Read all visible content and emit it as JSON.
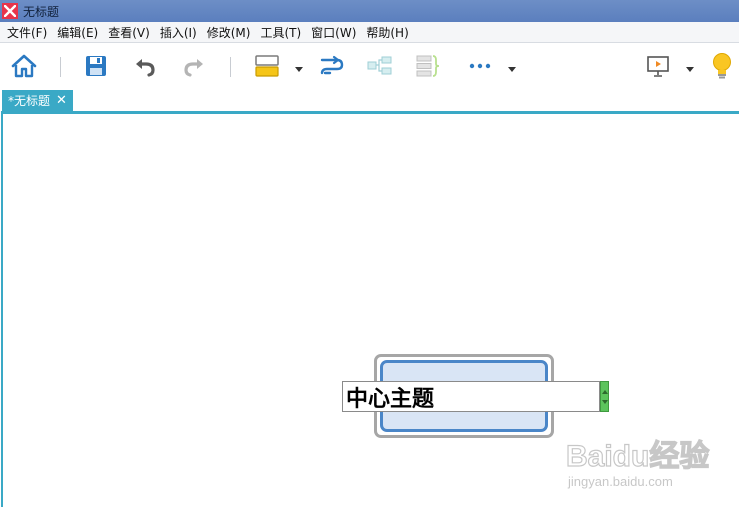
{
  "window": {
    "title": "无标题"
  },
  "menu": {
    "items": [
      {
        "label": "文件(F)"
      },
      {
        "label": "编辑(E)"
      },
      {
        "label": "查看(V)"
      },
      {
        "label": "插入(I)"
      },
      {
        "label": "修改(M)"
      },
      {
        "label": "工具(T)"
      },
      {
        "label": "窗口(W)"
      },
      {
        "label": "帮助(H)"
      }
    ]
  },
  "toolbar": {
    "icons": [
      "home-icon",
      "save-icon",
      "undo-icon",
      "redo-icon",
      "layout-icon",
      "relationship-icon",
      "structure-icon",
      "summary-icon",
      "more-icon",
      "presentation-icon",
      "idea-bulb-icon"
    ]
  },
  "tabs": [
    {
      "label": "*无标题",
      "close": "✕"
    }
  ],
  "canvas": {
    "central_topic": {
      "text": "中心主题"
    }
  },
  "watermark": {
    "brand": "Baidu经验",
    "url": "jingyan.baidu.com"
  },
  "colors": {
    "accent": "#3aa9c6",
    "titlebar": "#5b7fbe",
    "topic_border": "#4a86c8",
    "topic_fill": "#d9e5f5",
    "app_logo": "#e8344a"
  }
}
